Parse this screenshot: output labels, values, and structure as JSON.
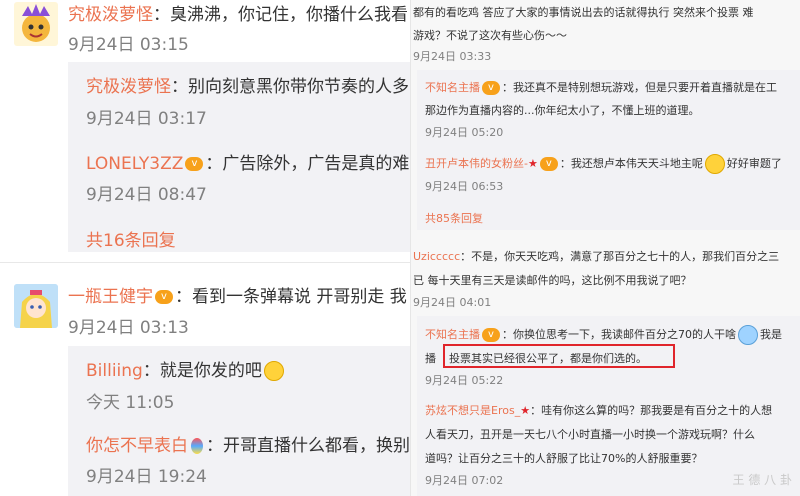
{
  "left": {
    "comment1": {
      "user": "究极泼萝怪",
      "text": "：臭沸沸，你记住，你播什么我看",
      "time": "9月24日 03:15",
      "replies": [
        {
          "user": "究极泼萝怪",
          "text": "：别向刻意黑你带你节奏的人多",
          "time": "9月24日 03:17"
        },
        {
          "user": "LONELY3ZZ",
          "text": "：广告除外，广告是真的难",
          "time": "9月24日 08:47"
        }
      ],
      "more": "共16条回复"
    },
    "comment2": {
      "user": "一瓶王健宇",
      "text": "：看到一条弹幕说  开哥别走 我",
      "time": "9月24日 03:13",
      "replies": [
        {
          "user": "Billiing",
          "text": "：就是你发的吧",
          "time": "今天 11:05"
        },
        {
          "user": "你怎不早表白",
          "text": "：开哥直播什么都看，换别",
          "time": "9月24日 19:24"
        }
      ]
    }
  },
  "right": {
    "top_text_1": "都有的看吃鸡  答应了大家的事情说出去的话就得执行  突然来个投票  难",
    "top_text_2": "游戏？不说了这次有些心伤～～",
    "top_time": "9月24日 03:33",
    "reply1": {
      "user": "不知名主播",
      "text1": "：我还真不是特别想玩游戏，但是只要开着直播就是在工",
      "text2": "那边作为直播内容的...你年纪太小了，不懂上班的道理。",
      "time": "9月24日 05:20"
    },
    "reply2": {
      "user": "丑开卢本伟的女粉丝-",
      "text": "：我还想卢本伟天天斗地主呢",
      "text_after": "好好审题了",
      "time": "9月24日 06:53"
    },
    "more": "共85条回复",
    "comment": {
      "user": "Uziccccc",
      "text1": "：不是，你天天吃鸡，满意了那百分之七十的人，那我们百分之三",
      "text2": "已 每十天里有三天是读邮件的吗，这比例不用我说了吧？",
      "time": "9月24日 04:01"
    },
    "reply3": {
      "user": "不知名主播",
      "text1": "：你换位思考一下，我读邮件百分之70的人干啥",
      "text1_after": "我是",
      "text2_prefix": "播",
      "highlight": "投票其实已经很公平了，都是你们选的。",
      "time": "9月24日 05:22"
    },
    "reply4": {
      "user": "苏炫不想只是Eros_",
      "text1": "：哇有你这么算的吗？那我要是有百分之十的人想",
      "text2": "人看天刀，丑开是一天七八个小时直播一小时换一个游戏玩啊？什么",
      "text3": "道吗？让百分之三十的人舒服了比让70%的人舒服重要？",
      "time": "9月24日 07:02"
    },
    "watermark": "王 德 八 卦"
  },
  "colors": {
    "accent": "#eb7350",
    "time": "#808080",
    "highlight": "#e0252b"
  }
}
